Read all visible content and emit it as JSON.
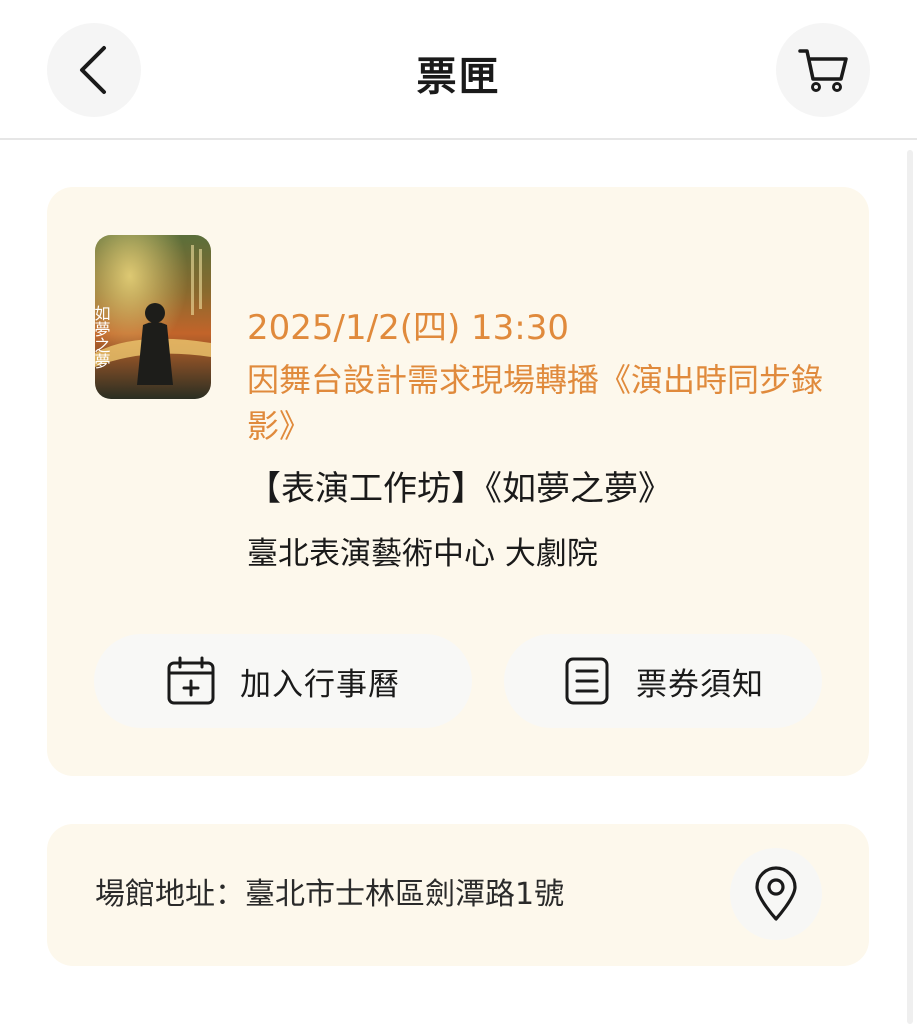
{
  "header": {
    "title": "票匣",
    "back_icon": "chevron-left-icon",
    "cart_icon": "cart-icon"
  },
  "ticket": {
    "datetime": "2025/1/2(四) 13:30",
    "notice": "因舞台設計需求現場轉播《演出時同步錄影》",
    "title": "【表演工作坊】《如夢之夢》",
    "venue": "臺北表演藝術中心 大劇院",
    "poster_text": "如夢之夢",
    "actions": {
      "calendar_label": "加入行事曆",
      "notice_label": "票券須知"
    }
  },
  "address": {
    "label": "場館地址：臺北市士林區劍潭路1號",
    "map_icon": "map-pin-icon"
  },
  "colors": {
    "accent": "#e08a3c",
    "card_bg": "#fdf8ec",
    "text": "#1a1a1a"
  }
}
